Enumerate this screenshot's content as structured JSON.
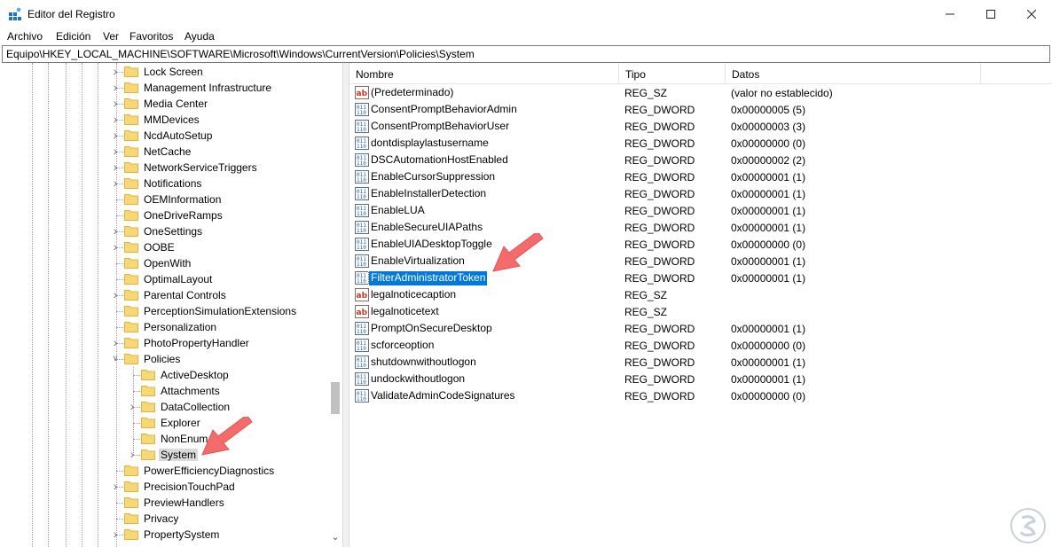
{
  "window": {
    "title": "Editor del Registro",
    "icon": "registry-editor-icon",
    "controls": {
      "minimize": "minimize-icon",
      "maximize": "maximize-icon",
      "close": "close-icon"
    }
  },
  "menu": [
    "Archivo",
    "Edición",
    "Ver",
    "Favoritos",
    "Ayuda"
  ],
  "address": "Equipo\\HKEY_LOCAL_MACHINE\\SOFTWARE\\Microsoft\\Windows\\CurrentVersion\\Policies\\System",
  "tree": {
    "items": [
      {
        "label": "Lock Screen",
        "level": 0,
        "expander": "collapsed"
      },
      {
        "label": "Management Infrastructure",
        "level": 0,
        "expander": "collapsed"
      },
      {
        "label": "Media Center",
        "level": 0,
        "expander": "collapsed"
      },
      {
        "label": "MMDevices",
        "level": 0,
        "expander": "collapsed"
      },
      {
        "label": "NcdAutoSetup",
        "level": 0,
        "expander": "collapsed"
      },
      {
        "label": "NetCache",
        "level": 0,
        "expander": "collapsed"
      },
      {
        "label": "NetworkServiceTriggers",
        "level": 0,
        "expander": "collapsed"
      },
      {
        "label": "Notifications",
        "level": 0,
        "expander": "collapsed"
      },
      {
        "label": "OEMInformation",
        "level": 0,
        "expander": "none"
      },
      {
        "label": "OneDriveRamps",
        "level": 0,
        "expander": "none"
      },
      {
        "label": "OneSettings",
        "level": 0,
        "expander": "collapsed"
      },
      {
        "label": "OOBE",
        "level": 0,
        "expander": "collapsed"
      },
      {
        "label": "OpenWith",
        "level": 0,
        "expander": "none"
      },
      {
        "label": "OptimalLayout",
        "level": 0,
        "expander": "none"
      },
      {
        "label": "Parental Controls",
        "level": 0,
        "expander": "collapsed"
      },
      {
        "label": "PerceptionSimulationExtensions",
        "level": 0,
        "expander": "none"
      },
      {
        "label": "Personalization",
        "level": 0,
        "expander": "none"
      },
      {
        "label": "PhotoPropertyHandler",
        "level": 0,
        "expander": "collapsed"
      },
      {
        "label": "Policies",
        "level": 0,
        "expander": "expanded"
      },
      {
        "label": "ActiveDesktop",
        "level": 1,
        "expander": "none"
      },
      {
        "label": "Attachments",
        "level": 1,
        "expander": "none"
      },
      {
        "label": "DataCollection",
        "level": 1,
        "expander": "collapsed"
      },
      {
        "label": "Explorer",
        "level": 1,
        "expander": "none"
      },
      {
        "label": "NonEnum",
        "level": 1,
        "expander": "none"
      },
      {
        "label": "System",
        "level": 1,
        "expander": "collapsed",
        "selected": true
      },
      {
        "label": "PowerEfficiencyDiagnostics",
        "level": 0,
        "expander": "none"
      },
      {
        "label": "PrecisionTouchPad",
        "level": 0,
        "expander": "collapsed"
      },
      {
        "label": "PreviewHandlers",
        "level": 0,
        "expander": "none"
      },
      {
        "label": "Privacy",
        "level": 0,
        "expander": "none"
      },
      {
        "label": "PropertySystem",
        "level": 0,
        "expander": "collapsed"
      }
    ]
  },
  "list": {
    "columns": [
      "Nombre",
      "Tipo",
      "Datos"
    ],
    "rows": [
      {
        "name": "(Predeterminado)",
        "type": "REG_SZ",
        "data": "(valor no establecido)",
        "icon": "string-value-icon"
      },
      {
        "name": "ConsentPromptBehaviorAdmin",
        "type": "REG_DWORD",
        "data": "0x00000005 (5)",
        "icon": "binary-value-icon"
      },
      {
        "name": "ConsentPromptBehaviorUser",
        "type": "REG_DWORD",
        "data": "0x00000003 (3)",
        "icon": "binary-value-icon"
      },
      {
        "name": "dontdisplaylastusername",
        "type": "REG_DWORD",
        "data": "0x00000000 (0)",
        "icon": "binary-value-icon"
      },
      {
        "name": "DSCAutomationHostEnabled",
        "type": "REG_DWORD",
        "data": "0x00000002 (2)",
        "icon": "binary-value-icon"
      },
      {
        "name": "EnableCursorSuppression",
        "type": "REG_DWORD",
        "data": "0x00000001 (1)",
        "icon": "binary-value-icon"
      },
      {
        "name": "EnableInstallerDetection",
        "type": "REG_DWORD",
        "data": "0x00000001 (1)",
        "icon": "binary-value-icon"
      },
      {
        "name": "EnableLUA",
        "type": "REG_DWORD",
        "data": "0x00000001 (1)",
        "icon": "binary-value-icon"
      },
      {
        "name": "EnableSecureUIAPaths",
        "type": "REG_DWORD",
        "data": "0x00000001 (1)",
        "icon": "binary-value-icon"
      },
      {
        "name": "EnableUIADesktopToggle",
        "type": "REG_DWORD",
        "data": "0x00000000 (0)",
        "icon": "binary-value-icon"
      },
      {
        "name": "EnableVirtualization",
        "type": "REG_DWORD",
        "data": "0x00000001 (1)",
        "icon": "binary-value-icon"
      },
      {
        "name": "FilterAdministratorToken",
        "type": "REG_DWORD",
        "data": "0x00000001 (1)",
        "icon": "binary-value-icon",
        "selected": true
      },
      {
        "name": "legalnoticecaption",
        "type": "REG_SZ",
        "data": "",
        "icon": "string-value-icon"
      },
      {
        "name": "legalnoticetext",
        "type": "REG_SZ",
        "data": "",
        "icon": "string-value-icon"
      },
      {
        "name": "PromptOnSecureDesktop",
        "type": "REG_DWORD",
        "data": "0x00000001 (1)",
        "icon": "binary-value-icon"
      },
      {
        "name": "scforceoption",
        "type": "REG_DWORD",
        "data": "0x00000000 (0)",
        "icon": "binary-value-icon"
      },
      {
        "name": "shutdownwithoutlogon",
        "type": "REG_DWORD",
        "data": "0x00000001 (1)",
        "icon": "binary-value-icon"
      },
      {
        "name": "undockwithoutlogon",
        "type": "REG_DWORD",
        "data": "0x00000001 (1)",
        "icon": "binary-value-icon"
      },
      {
        "name": "ValidateAdminCodeSignatures",
        "type": "REG_DWORD",
        "data": "0x00000000 (0)",
        "icon": "binary-value-icon"
      }
    ]
  },
  "colors": {
    "selection": "#0078d7",
    "folder": "#f8d775",
    "annotation_arrow": "#f46b6b"
  }
}
